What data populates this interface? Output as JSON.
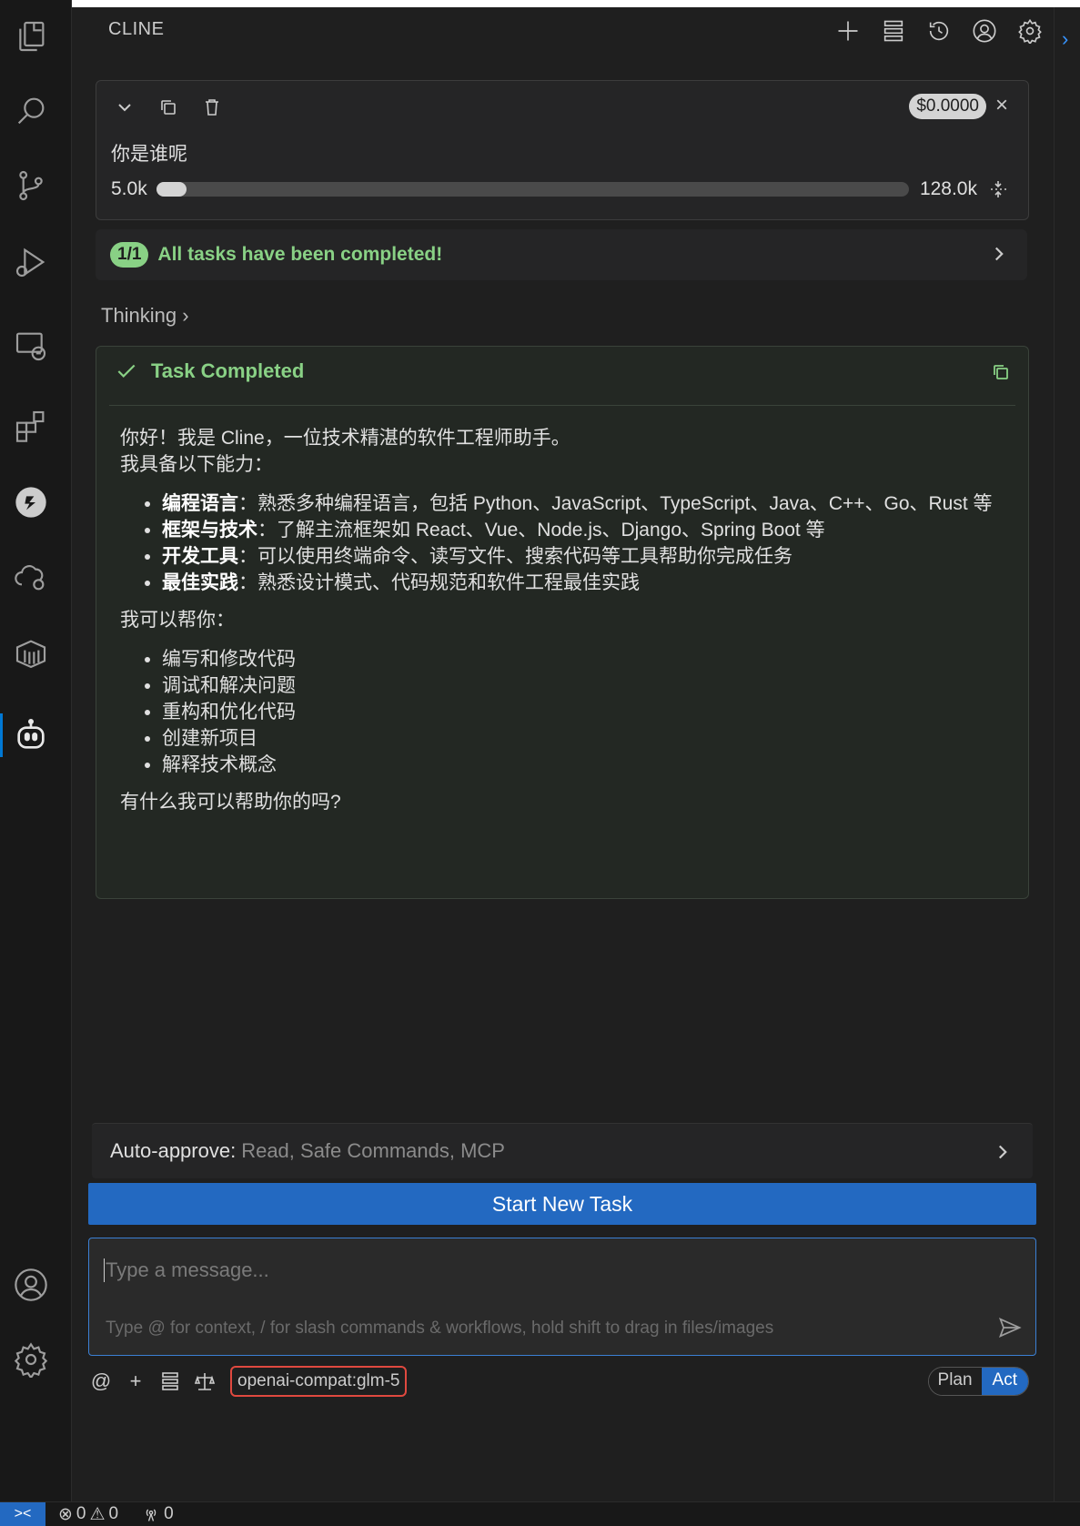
{
  "panel": {
    "title": "CLINE"
  },
  "task": {
    "text": "你是谁呢",
    "cost": "$0.0000",
    "close_glyph": "×",
    "context_used": "5.0k",
    "context_max": "128.0k",
    "context_fill_fraction": 0.04
  },
  "progress": {
    "badge": "1/1",
    "text": "All tasks have been completed!"
  },
  "thinking": "Thinking ›",
  "completion": {
    "title": "Task Completed",
    "intro_line1": "你好！我是 Cline，一位技术精湛的软件工程师助手。",
    "intro_line2": "我具备以下能力：",
    "abilities": [
      {
        "label": "编程语言",
        "text": "：熟悉多种编程语言，包括 Python、JavaScript、TypeScript、Java、C++、Go、Rust 等"
      },
      {
        "label": "框架与技术",
        "text": "：了解主流框架如 React、Vue、Node.js、Django、Spring Boot 等"
      },
      {
        "label": "开发工具",
        "text": "：可以使用终端命令、读写文件、搜索代码等工具帮助你完成任务"
      },
      {
        "label": "最佳实践",
        "text": "：熟悉设计模式、代码规范和软件工程最佳实践"
      }
    ],
    "help_heading": "我可以帮你：",
    "help_items": [
      "编写和修改代码",
      "调试和解决问题",
      "重构和优化代码",
      "创建新项目",
      "解释技术概念"
    ],
    "closing": "有什么我可以帮助你的吗?"
  },
  "auto_approve": {
    "label": "Auto-approve:",
    "value": "Read, Safe Commands, MCP"
  },
  "start_button": "Start New Task",
  "input": {
    "placeholder": "Type a message...",
    "hint": "Type @ for context, / for slash commands & workflows, hold shift to drag in files/images"
  },
  "bottom": {
    "at_glyph": "@",
    "plus_glyph": "+",
    "model": "openai-compat:glm-5",
    "mode_plan": "Plan",
    "mode_act": "Act"
  },
  "status_bar": {
    "remote_glyph": "><",
    "errors": "0",
    "warnings": "0",
    "ports": "0"
  },
  "colors": {
    "accent": "#2369c1",
    "success": "#89d185",
    "highlight_border": "#e0493f"
  },
  "icons": {
    "activity": [
      "explorer-icon",
      "search-icon",
      "source-control-icon",
      "run-debug-icon",
      "remote-explorer-icon",
      "extensions-icon",
      "gitlens-icon",
      "cloud-icon",
      "containers-icon",
      "cline-icon",
      "account-icon",
      "manage-gear-icon"
    ],
    "toolbar": [
      "new-task-icon",
      "mcp-servers-icon",
      "history-icon",
      "account-icon",
      "settings-icon"
    ]
  }
}
